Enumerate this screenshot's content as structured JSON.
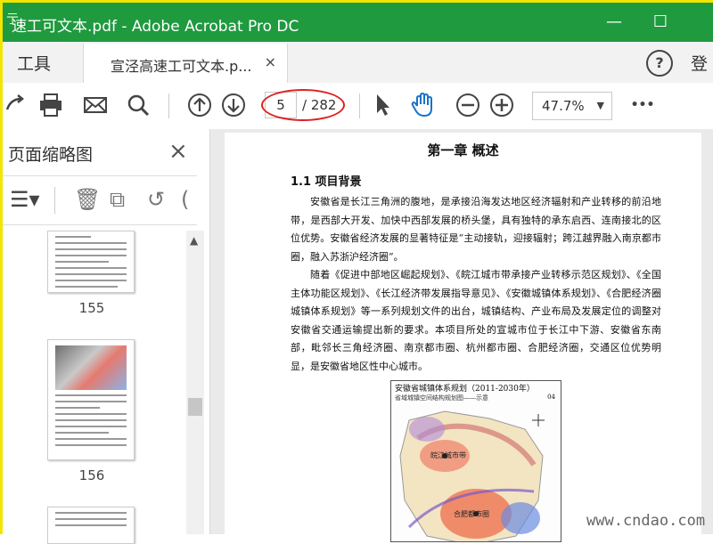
{
  "window": {
    "title": "速工可文本.pdf - Adobe Acrobat Pro DC",
    "minimize": "—",
    "maximize": "☐"
  },
  "tabs": {
    "tools_label": "工具",
    "doc_label": "宣泾高速工可文本.p...",
    "close": "×",
    "signin": "登"
  },
  "toolbar": {
    "page_current": "5",
    "page_total": "/ 282",
    "zoom": "47.7%",
    "more": "•••"
  },
  "thumbnails": {
    "title": "页面缩略图",
    "close": "×",
    "pages": [
      "155",
      "156"
    ]
  },
  "document": {
    "chapter": "第一章  概述",
    "section": "1.1   项目背景",
    "para1": "安徽省是长江三角洲的腹地，是承接沿海发达地区经济辐射和产业转移的前沿地带，是西部大开发、加快中西部发展的桥头堡，具有独特的承东启西、连南接北的区位优势。安徽省经济发展的显著特征是“主动接轨，迎接辐射；跨江越界融入南京都市圈，融入苏浙沪经济圈”。",
    "para2": "随着《促进中部地区崛起规划》、《皖江城市带承接产业转移示范区规划》、《全国主体功能区规划》、《长江经济带发展指导意见》、《安徽城镇体系规划》、《合肥经济圈城镇体系规划》等一系列规划文件的出台，城镇结构、产业布局及发展定位的调整对安徽省交通运输提出新的要求。本项目所处的宣城市位于长江中下游、安徽省东南部，毗邻长三角经济圈、南京都市圈、杭州都市圈、合肥经济圈，交通区位优势明显，是安徽省地区性中心城市。",
    "map_title": "安徽省城镇体系规划（2011-2030年）",
    "map_subtitle": "省域城镇空间结构规划图——示意",
    "map_no": "04",
    "map_label1": "皖江城市带",
    "map_label2": "合肥都市圈"
  },
  "watermark": "www.cndao.com",
  "colors": {
    "titlebar": "#1f9a3f",
    "annotation_red": "#dd2222",
    "hand_tool_blue": "#1a73c8"
  }
}
